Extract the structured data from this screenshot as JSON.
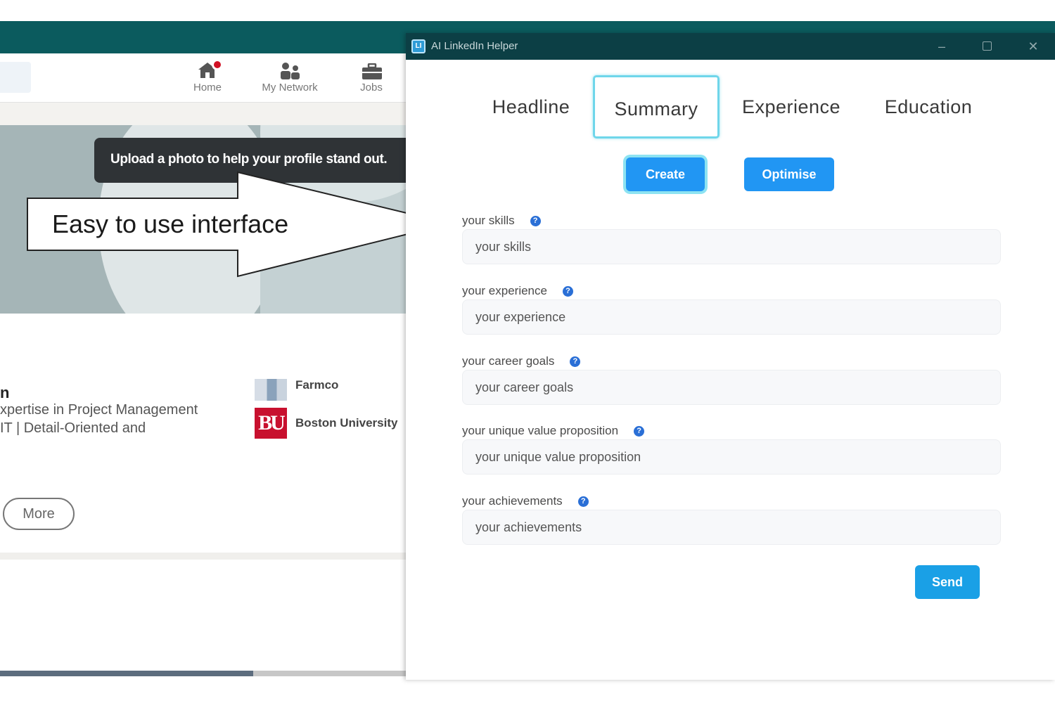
{
  "linkedin": {
    "nav": [
      {
        "label": "Home",
        "icon": "home-icon"
      },
      {
        "label": "My Network",
        "icon": "network-icon"
      },
      {
        "label": "Jobs",
        "icon": "briefcase-icon"
      }
    ],
    "tooltip": "Upload a photo to help your profile stand out.",
    "name_fragment": "n",
    "headline_line1": "xpertise in Project Management",
    "headline_line2": "IT | Detail-Oriented and",
    "orgs": [
      {
        "name": "Farmco",
        "logo": "building-logo"
      },
      {
        "name": "Boston University",
        "logo_text": "BU"
      }
    ],
    "more_label": "More"
  },
  "callout": {
    "text": "Easy to use interface"
  },
  "app": {
    "title": "AI LinkedIn Helper",
    "icon_text": "LI",
    "window_controls": {
      "minimize": "–",
      "close": "✕"
    },
    "tabs": [
      {
        "label": "Headline",
        "active": false
      },
      {
        "label": "Summary",
        "active": true
      },
      {
        "label": "Experience",
        "active": false
      },
      {
        "label": "Education",
        "active": false
      }
    ],
    "actions": {
      "create": "Create",
      "optimise": "Optimise"
    },
    "help_glyph": "?",
    "fields": [
      {
        "label": "your skills",
        "placeholder": "your skills",
        "value": ""
      },
      {
        "label": "your experience",
        "placeholder": "your experience",
        "value": ""
      },
      {
        "label": "your career goals",
        "placeholder": "your career goals",
        "value": ""
      },
      {
        "label": "your unique value proposition",
        "placeholder": "your unique value proposition",
        "value": ""
      },
      {
        "label": "your achievements",
        "placeholder": "your achievements",
        "value": ""
      }
    ],
    "send_label": "Send",
    "colors": {
      "titlebar": "#0c3f45",
      "button_blue": "#2196f3",
      "active_tab_border": "#6fd6ea",
      "help_icon": "#2a6fd6"
    }
  }
}
